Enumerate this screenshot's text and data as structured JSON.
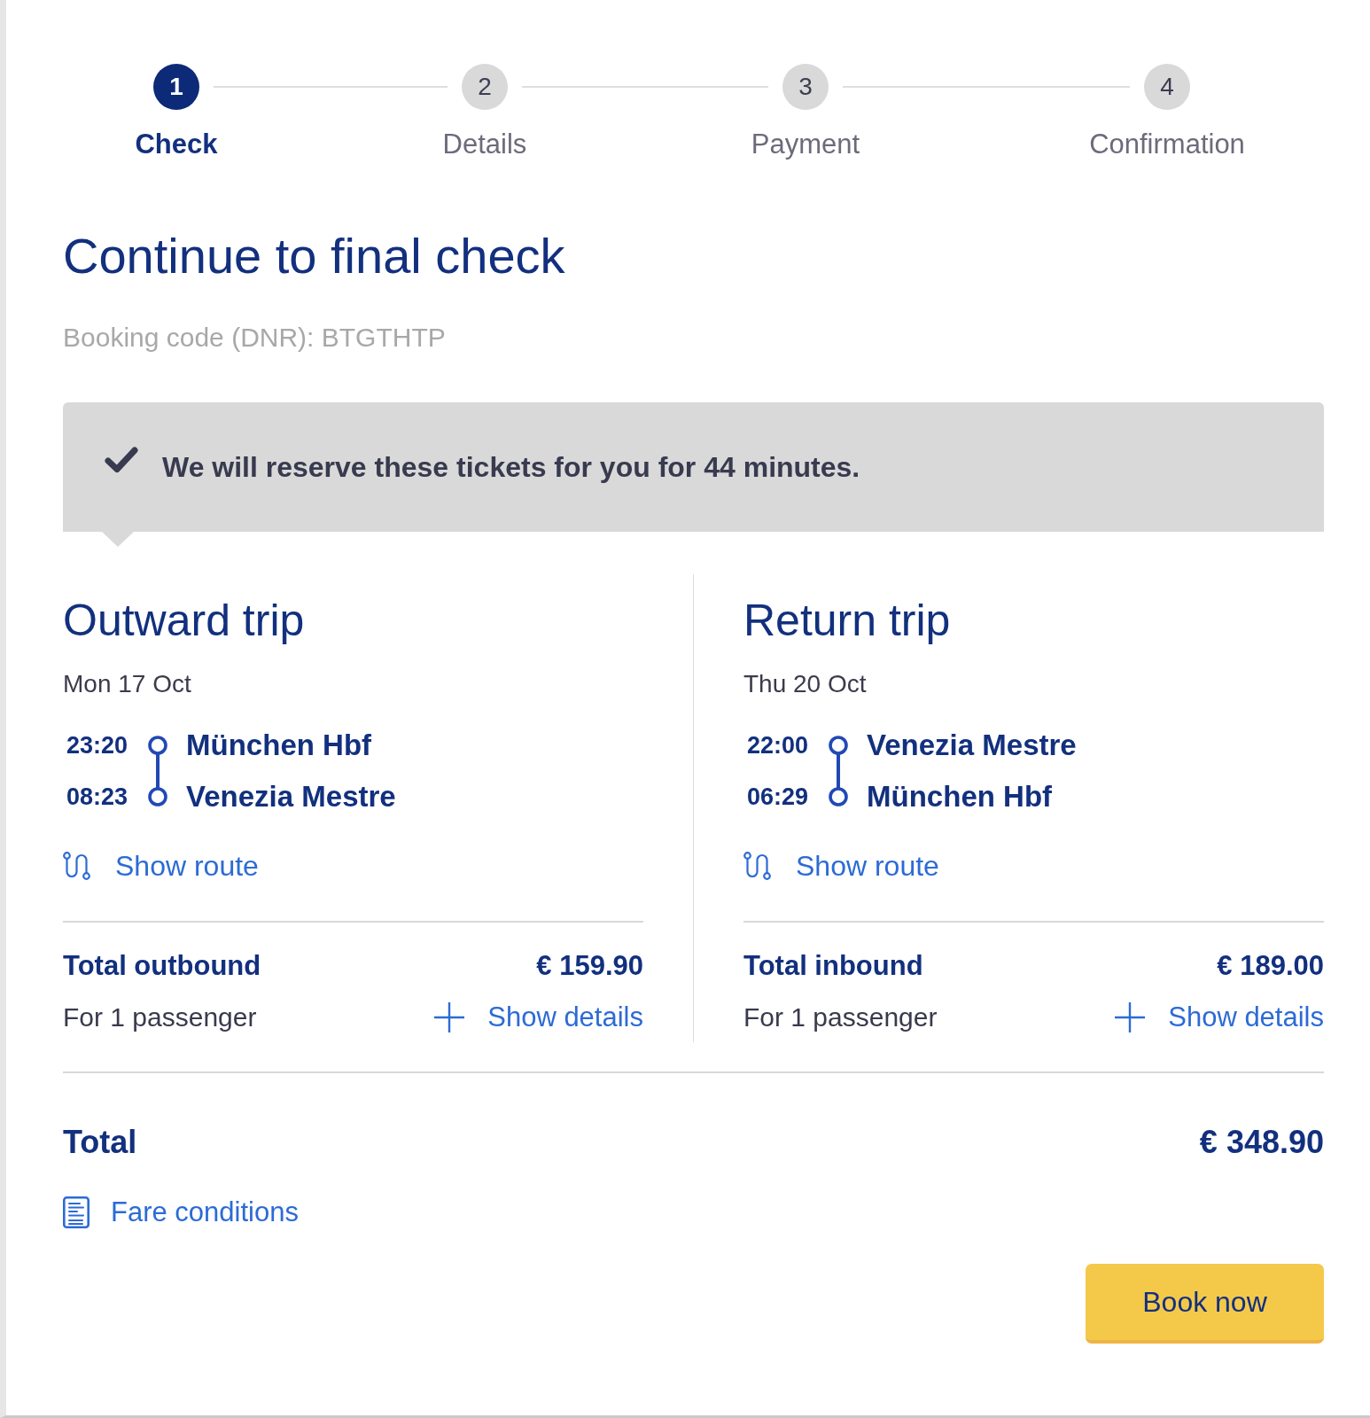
{
  "stepper": {
    "steps": [
      {
        "number": "1",
        "label": "Check",
        "selected": true
      },
      {
        "number": "2",
        "label": "Details",
        "selected": false
      },
      {
        "number": "3",
        "label": "Payment",
        "selected": false
      },
      {
        "number": "4",
        "label": "Confirmation",
        "selected": false
      }
    ]
  },
  "header": {
    "title": "Continue to final check",
    "booking_code": "Booking code (DNR): BTGTHTP"
  },
  "notice": {
    "text": "We will reserve these tickets for you for 44 minutes."
  },
  "trips": [
    {
      "title": "Outward trip",
      "date": "Mon 17 Oct",
      "stops": [
        {
          "time": "23:20",
          "station": "München Hbf"
        },
        {
          "time": "08:23",
          "station": "Venezia Mestre"
        }
      ],
      "route_link": "Show route",
      "total_label": "Total outbound",
      "total_price": "€ 159.90",
      "passengers": "For 1 passenger",
      "details_link": "Show details"
    },
    {
      "title": "Return trip",
      "date": "Thu 20 Oct",
      "stops": [
        {
          "time": "22:00",
          "station": "Venezia Mestre"
        },
        {
          "time": "06:29",
          "station": "München Hbf"
        }
      ],
      "route_link": "Show route",
      "total_label": "Total inbound",
      "total_price": "€ 189.00",
      "passengers": "For 1 passenger",
      "details_link": "Show details"
    }
  ],
  "total": {
    "label": "Total",
    "price": "€ 348.90"
  },
  "fare_conditions_link": "Fare conditions",
  "book_button": "Book now"
}
